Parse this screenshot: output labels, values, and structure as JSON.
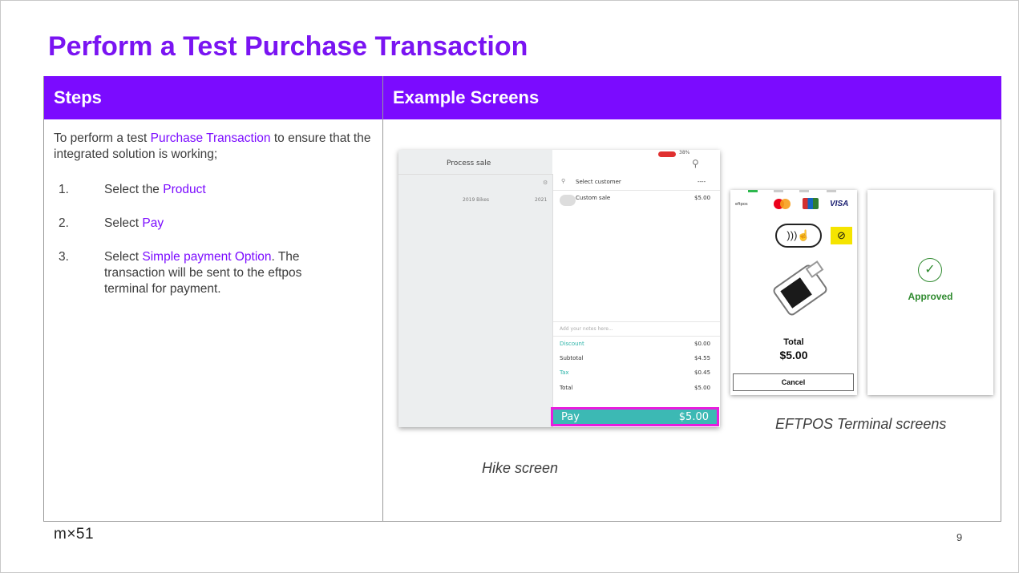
{
  "title": "Perform a Test Purchase Transaction",
  "table": {
    "col_steps": "Steps",
    "col_examples": "Example Screens"
  },
  "intro": {
    "pre": "To perform a test ",
    "highlight": "Purchase Transaction",
    "post": " to ensure that the integrated solution is working;"
  },
  "steps": [
    {
      "num": "1.",
      "pre": "Select the ",
      "highlight": "Product",
      "post": ""
    },
    {
      "num": "2.",
      "pre": "Select ",
      "highlight": "Pay",
      "post": ""
    },
    {
      "num": "3.",
      "pre": "Select ",
      "highlight": "Simple payment Option",
      "post": ". The transaction will be sent to the eftpos terminal for payment."
    }
  ],
  "hike": {
    "header": "Process sale",
    "status": "38%",
    "select_customer": "Select customer",
    "dots": "----",
    "left_row": [
      "2019 Bikes",
      "2021"
    ],
    "custom_sale": "Custom sale",
    "custom_sale_amount": "$5.00",
    "notes_placeholder": "Add your notes here...",
    "lines": [
      {
        "label": "Discount",
        "value": "$0.00"
      },
      {
        "label": "Subtotal",
        "value": "$4.55"
      },
      {
        "label": "Tax",
        "value": "$0.45"
      },
      {
        "label": "Total",
        "value": "$5.00"
      }
    ],
    "pay_label": "Pay",
    "pay_amount": "$5.00"
  },
  "terminal": {
    "eftpos_logo": "eftpos",
    "visa": "VISA",
    "total_label": "Total",
    "total_amount": "$5.00",
    "cancel": "Cancel",
    "approved": "Approved"
  },
  "captions": {
    "terminal": "EFTPOS Terminal screens",
    "hike": "Hike screen"
  },
  "footer": {
    "logo": "m×51",
    "page": "9"
  },
  "colors": {
    "accent": "#7b0bff",
    "pay_bar": "#3cb9b4",
    "pay_highlight": "#e81cde",
    "approved": "#2f8a2f"
  }
}
